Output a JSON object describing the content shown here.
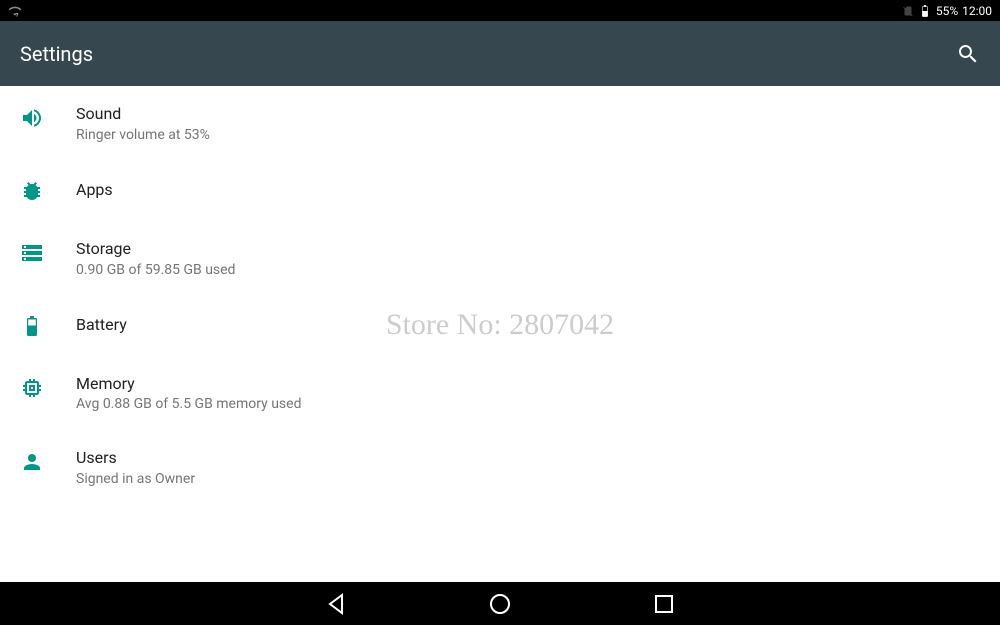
{
  "statusbar": {
    "battery_pct": "55%",
    "clock": "12:00"
  },
  "header": {
    "title": "Settings"
  },
  "items": [
    {
      "icon": "volume-up-icon",
      "title": "Sound",
      "subtitle": "Ringer volume at 53%"
    },
    {
      "icon": "apps-icon",
      "title": "Apps",
      "subtitle": ""
    },
    {
      "icon": "storage-icon",
      "title": "Storage",
      "subtitle": "0.90 GB of 59.85 GB used"
    },
    {
      "icon": "battery-icon",
      "title": "Battery",
      "subtitle": ""
    },
    {
      "icon": "memory-icon",
      "title": "Memory",
      "subtitle": "Avg 0.88 GB of 5.5 GB memory used"
    },
    {
      "icon": "user-icon",
      "title": "Users",
      "subtitle": "Signed in as Owner"
    }
  ],
  "watermark": "Store No: 2807042",
  "colors": {
    "accent": "#009688",
    "header": "#37474f"
  }
}
